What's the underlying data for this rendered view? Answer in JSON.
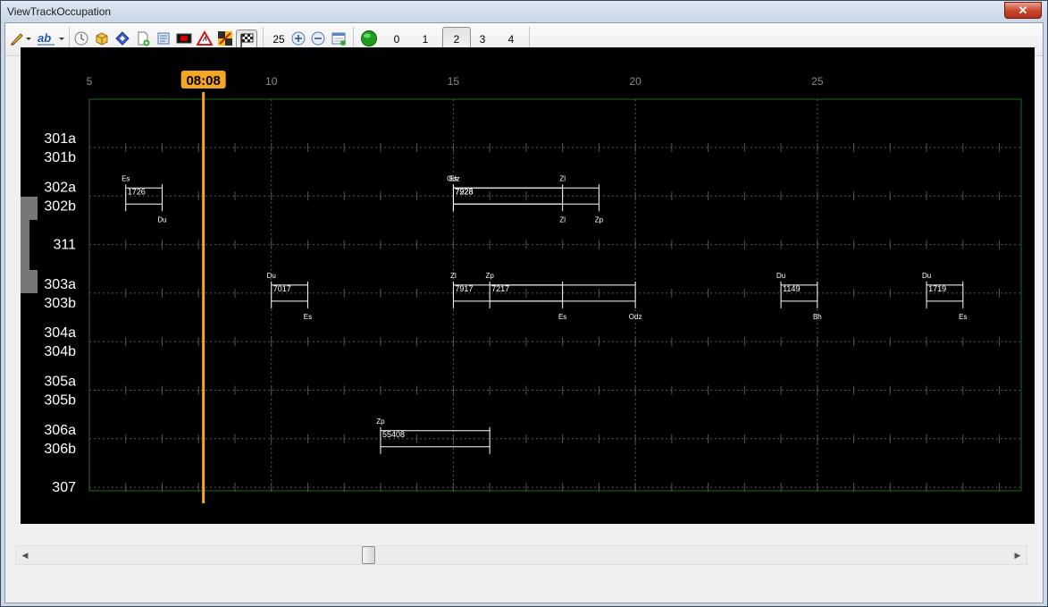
{
  "window": {
    "title": "ViewTrackOccupation",
    "close_label": "✕"
  },
  "toolbar": {
    "zoom_value": "25",
    "levels": [
      "0",
      "1",
      "2",
      "3",
      "4"
    ],
    "selected_level": "2",
    "icons": [
      "pencil-icon",
      "text-ab-icon",
      "clock-icon",
      "package-icon",
      "diamond-icon",
      "new-page-icon",
      "scroll-icon",
      "record-icon",
      "warning-icon",
      "grid-icon",
      "checkered-flag-icon",
      "zoom-in-icon",
      "zoom-out-icon",
      "table-refresh-icon",
      "status-green-icon"
    ]
  },
  "chart": {
    "current_time": "08:08",
    "time_axis": {
      "min": 5,
      "max": 30.6,
      "ticks": [
        "5",
        "10",
        "15",
        "20",
        "25"
      ],
      "tick_values": [
        5,
        10,
        15,
        20,
        25
      ]
    },
    "tracks": [
      {
        "label": "301a",
        "row": 0
      },
      {
        "label": "301b",
        "row": 0
      },
      {
        "label": "302a",
        "row": 1
      },
      {
        "label": "302b",
        "row": 1
      },
      {
        "label": "311",
        "row": 2
      },
      {
        "label": "303a",
        "row": 3
      },
      {
        "label": "303b",
        "row": 3
      },
      {
        "label": "304a",
        "row": 4
      },
      {
        "label": "304b",
        "row": 4
      },
      {
        "label": "305a",
        "row": 5
      },
      {
        "label": "305b",
        "row": 5
      },
      {
        "label": "306a",
        "row": 6
      },
      {
        "label": "306b",
        "row": 6
      },
      {
        "label": "307",
        "row": 7
      }
    ],
    "occupations": [
      {
        "train": "1726",
        "row": 1,
        "start": 6,
        "end": 7,
        "start_code": "Es",
        "end_code": "Du"
      },
      {
        "train": "7228",
        "row": 1,
        "start": 15,
        "end": 19,
        "start_code": "Es",
        "end_code": "Zp",
        "mid_code": "Zl",
        "mid_time": 18
      },
      {
        "train": "7928",
        "row": 1,
        "start": 15,
        "end": 18,
        "start_code": "Odz",
        "end_code": "Zl"
      },
      {
        "train": "7017",
        "row": 3,
        "start": 10,
        "end": 11,
        "start_code": "Du",
        "end_code": "Es"
      },
      {
        "train": "7917",
        "row": 3,
        "start": 15,
        "end": 18,
        "start_code": "Zl",
        "end_code": "Es"
      },
      {
        "train": "7217",
        "row": 3,
        "start": 16,
        "end": 20,
        "start_code": "Zp",
        "end_code": "Odz"
      },
      {
        "train": "1149",
        "row": 3,
        "start": 24,
        "end": 25,
        "start_code": "Du",
        "end_code": "Bh"
      },
      {
        "train": "1719",
        "row": 3,
        "start": 28,
        "end": 29,
        "start_code": "Du",
        "end_code": "Es"
      },
      {
        "train": "55408",
        "row": 6,
        "start": 13,
        "end": 16,
        "start_code": "Zp",
        "end_code": ""
      }
    ],
    "colors": {
      "background": "#000000",
      "border": "#1c6b1c",
      "grid": "#555555",
      "bars": "#ffffff",
      "now_line": "#f5a623",
      "labels": "#ffffff",
      "axis_ticks": "#8a8a8a"
    }
  },
  "scrollbar": {
    "left_arrow": "◀",
    "right_arrow": "▶"
  }
}
